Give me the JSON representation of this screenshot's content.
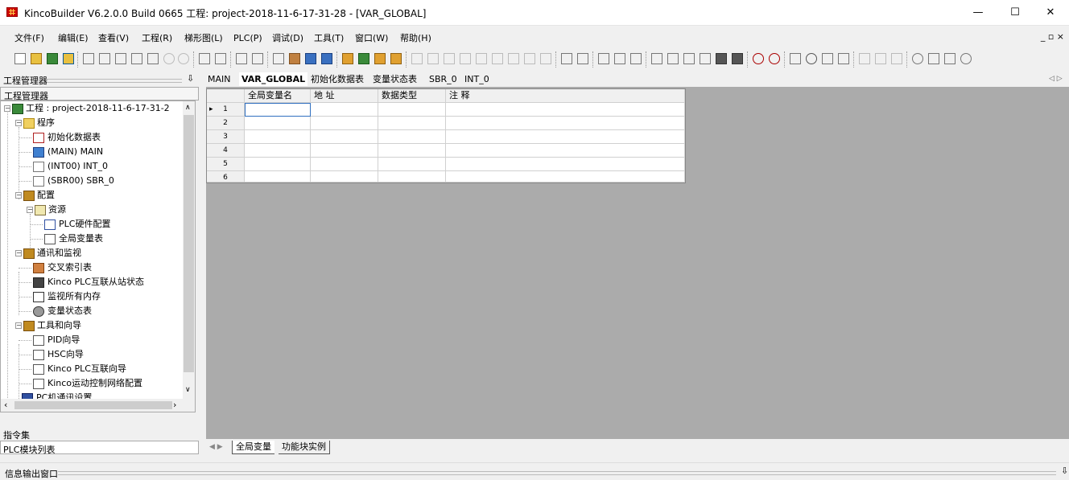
{
  "window": {
    "title": "KincoBuilder V6.2.0.0 Build 0665   工程: project-2018-11-6-17-31-28 - [VAR_GLOBAL]",
    "minimize": "—",
    "maximize": "☐",
    "close": "✕"
  },
  "menu": {
    "items": [
      "文件(F)",
      "编辑(E)",
      "查看(V)",
      "工程(R)",
      "梯形图(L)",
      "PLC(P)",
      "调试(D)",
      "工具(T)",
      "窗口(W)",
      "帮助(H)"
    ],
    "mdi_controls": "_ ▫ ×"
  },
  "project_manager": {
    "header": "工程管理器",
    "pin": "⇩",
    "tab": "工程管理器",
    "tree": [
      {
        "label": "工程 : project-2018-11-6-17-31-2",
        "icon": "project-icon"
      },
      {
        "label": "程序",
        "icon": "folder-icon"
      },
      {
        "label": "初始化数据表",
        "icon": "table-icon"
      },
      {
        "label": "(MAIN)  MAIN",
        "icon": "main-program-icon"
      },
      {
        "label": "(INT00)  INT_0",
        "icon": "interrupt-icon"
      },
      {
        "label": "(SBR00)  SBR_0",
        "icon": "subroutine-icon"
      },
      {
        "label": "配置",
        "icon": "config-icon"
      },
      {
        "label": "资源",
        "icon": "folder-icon"
      },
      {
        "label": "PLC硬件配置",
        "icon": "hardware-icon"
      },
      {
        "label": "全局变量表",
        "icon": "variable-table-icon"
      },
      {
        "label": "通讯和监视",
        "icon": "comm-icon"
      },
      {
        "label": "交叉索引表",
        "icon": "cross-ref-icon"
      },
      {
        "label": "Kinco PLC互联从站状态",
        "icon": "slave-status-icon"
      },
      {
        "label": "监视所有内存",
        "icon": "memory-icon"
      },
      {
        "label": "变量状态表",
        "icon": "status-table-icon"
      },
      {
        "label": "工具和向导",
        "icon": "tools-icon"
      },
      {
        "label": "PID向导",
        "icon": "wizard-icon"
      },
      {
        "label": "HSC向导",
        "icon": "wizard-icon"
      },
      {
        "label": "Kinco PLC互联向导",
        "icon": "wizard-icon"
      },
      {
        "label": "Kinco运动控制网络配置",
        "icon": "wizard-icon"
      },
      {
        "label": "PC机通讯设置",
        "icon": "pc-comm-icon"
      }
    ],
    "instructions": "指令集",
    "plc_modules": "PLC模块列表"
  },
  "editor": {
    "tabs": [
      "MAIN",
      "VAR_GLOBAL",
      "初始化数据表",
      "变量状态表",
      "SBR_0",
      "INT_0"
    ],
    "active_tab": "VAR_GLOBAL",
    "tab_scroll": "◁ ▷",
    "columns": [
      "全局变量名",
      "地 址",
      "数据类型",
      "注 释"
    ],
    "rows": [
      "1",
      "2",
      "3",
      "4",
      "5",
      "6"
    ],
    "current_row_marker": "▸",
    "sheet_nav": "◀ ▶",
    "sheet_tabs": [
      "全局变量",
      "功能块实例"
    ]
  },
  "output": {
    "label": "信息输出窗口",
    "pin": "⇩"
  }
}
